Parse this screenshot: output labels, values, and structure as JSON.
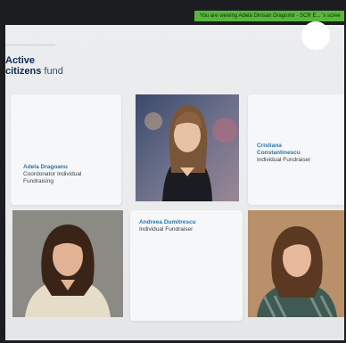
{
  "banner": {
    "text": "You are viewing Adela Dinisan Dragomir - SCR E... 's scree"
  },
  "brand": {
    "line1": "Active",
    "line2_bold": "citizens",
    "line2_light": " fund"
  },
  "team": [
    {
      "name": "Adela Dragoanu",
      "role_line1": "Coordonator Individual",
      "role_line2": "Fundraising"
    },
    {
      "name": "Cristiana",
      "name_line2": "Constantinescu",
      "role": "Individual Fundraiser"
    },
    {
      "name": "Andreea Dumitrescu",
      "role": "Individual Fundraiser"
    }
  ]
}
